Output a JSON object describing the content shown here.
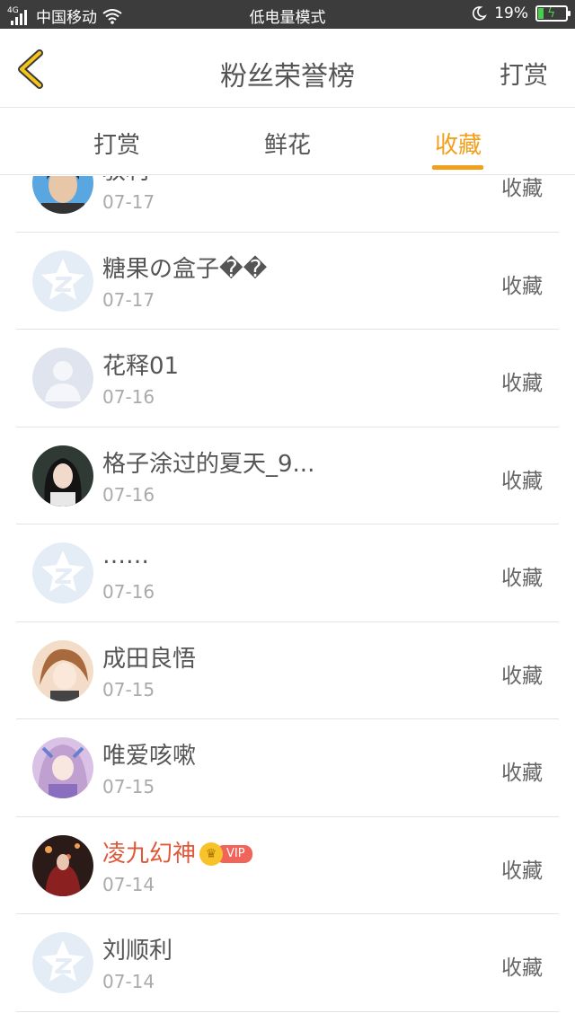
{
  "status_bar": {
    "network": "4G",
    "carrier": "中国移动",
    "mode": "低电量模式",
    "battery": "19%",
    "battery_level": 0.19
  },
  "header": {
    "title": "粉丝荣誉榜",
    "right_action": "打赏"
  },
  "tabs": [
    {
      "label": "打赏",
      "active": false
    },
    {
      "label": "鲜花",
      "active": false
    },
    {
      "label": "收藏",
      "active": true
    }
  ],
  "colors": {
    "accent": "#f0a01c",
    "vip_name": "#e0583a"
  },
  "list": [
    {
      "name": "驭利",
      "date": "07-17",
      "action": "收藏",
      "avatar": "photo-person"
    },
    {
      "name": "糖果の盒子��",
      "date": "07-17",
      "action": "收藏",
      "avatar": "default-star"
    },
    {
      "name": "花释01",
      "date": "07-16",
      "action": "收藏",
      "avatar": "default-person"
    },
    {
      "name": "格子涂过的夏天_9...",
      "date": "07-16",
      "action": "收藏",
      "avatar": "photo-girl"
    },
    {
      "name": "……",
      "date": "07-16",
      "action": "收藏",
      "avatar": "default-star"
    },
    {
      "name": "成田良悟",
      "date": "07-15",
      "action": "收藏",
      "avatar": "anime-1"
    },
    {
      "name": "唯爱咳嗽",
      "date": "07-15",
      "action": "收藏",
      "avatar": "anime-2"
    },
    {
      "name": "凌九幻神",
      "date": "07-14",
      "action": "收藏",
      "avatar": "photo-night",
      "vip": true,
      "vip_label": "VIP"
    },
    {
      "name": "刘顺利",
      "date": "07-14",
      "action": "收藏",
      "avatar": "default-star"
    }
  ]
}
